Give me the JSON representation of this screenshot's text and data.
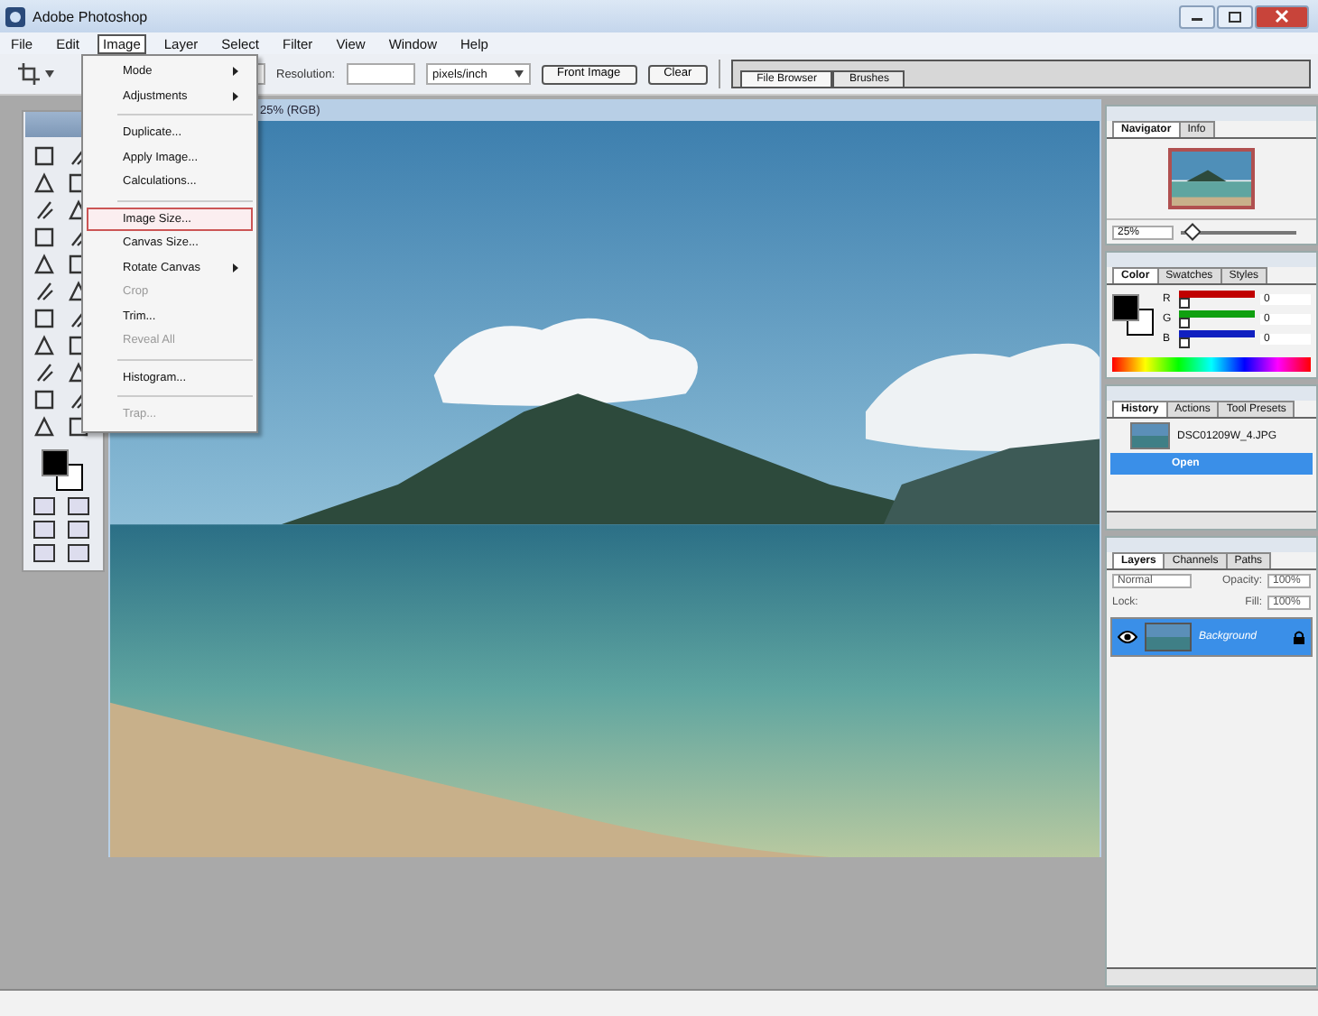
{
  "window": {
    "title": "Adobe Photoshop"
  },
  "menu": [
    {
      "label": "File",
      "selected": false
    },
    {
      "label": "Edit",
      "selected": false
    },
    {
      "label": "Image",
      "selected": true
    },
    {
      "label": "Layer",
      "selected": false
    },
    {
      "label": "Select",
      "selected": false
    },
    {
      "label": "Filter",
      "selected": false
    },
    {
      "label": "View",
      "selected": false
    },
    {
      "label": "Window",
      "selected": false
    },
    {
      "label": "Help",
      "selected": false
    }
  ],
  "options_bar": {
    "resolution_label": "Resolution:",
    "units": "pixels/inch",
    "front_image": "Front Image",
    "clear": "Clear"
  },
  "palette_well": [
    {
      "label": "File Browser",
      "selected": true
    },
    {
      "label": "Brushes",
      "selected": false
    }
  ],
  "image_menu": [
    {
      "kind": "item",
      "label": "Mode",
      "submenu": true,
      "disabled": false,
      "selected": false
    },
    {
      "kind": "item",
      "label": "Adjustments",
      "submenu": true,
      "disabled": false,
      "selected": false
    },
    {
      "kind": "separator"
    },
    {
      "kind": "item",
      "label": "Duplicate...",
      "submenu": false,
      "disabled": false,
      "selected": false
    },
    {
      "kind": "item",
      "label": "Apply Image...",
      "submenu": false,
      "disabled": false,
      "selected": false
    },
    {
      "kind": "item",
      "label": "Calculations...",
      "submenu": false,
      "disabled": false,
      "selected": false
    },
    {
      "kind": "separator"
    },
    {
      "kind": "item",
      "label": "Image Size...",
      "submenu": false,
      "disabled": false,
      "selected": true
    },
    {
      "kind": "item",
      "label": "Canvas Size...",
      "submenu": false,
      "disabled": false,
      "selected": false
    },
    {
      "kind": "item",
      "label": "Rotate Canvas",
      "submenu": true,
      "disabled": false,
      "selected": false
    },
    {
      "kind": "item",
      "label": "Crop",
      "submenu": false,
      "disabled": true,
      "selected": false
    },
    {
      "kind": "item",
      "label": "Trim...",
      "submenu": false,
      "disabled": false,
      "selected": false
    },
    {
      "kind": "item",
      "label": "Reveal All",
      "submenu": false,
      "disabled": true,
      "selected": false
    },
    {
      "kind": "separator"
    },
    {
      "kind": "item",
      "label": "Histogram...",
      "submenu": false,
      "disabled": false,
      "selected": false
    },
    {
      "kind": "separator"
    },
    {
      "kind": "item",
      "label": "Trap...",
      "submenu": false,
      "disabled": true,
      "selected": false
    }
  ],
  "document": {
    "title": "25% (RGB)"
  },
  "navigator": {
    "tabs": [
      {
        "label": "Navigator",
        "selected": true
      },
      {
        "label": "Info",
        "selected": false
      }
    ],
    "zoom": "25%",
    "level": 0.05
  },
  "color": {
    "tabs": [
      {
        "label": "Color",
        "selected": true
      },
      {
        "label": "Swatches",
        "selected": false
      },
      {
        "label": "Styles",
        "selected": false
      }
    ],
    "channels": [
      {
        "name": "R",
        "value": "0",
        "color": "#c00000",
        "level": 0
      },
      {
        "name": "G",
        "value": "0",
        "color": "#10a010",
        "level": 0
      },
      {
        "name": "B",
        "value": "0",
        "color": "#1020c0",
        "level": 0
      }
    ]
  },
  "history": {
    "tabs": [
      {
        "label": "History",
        "selected": true
      },
      {
        "label": "Actions",
        "selected": false
      },
      {
        "label": "Tool Presets",
        "selected": false
      }
    ],
    "snapshot": "DSC01209W_4.JPG",
    "states": [
      {
        "label": "Open",
        "selected": true
      }
    ]
  },
  "layers": {
    "tabs": [
      {
        "label": "Layers",
        "selected": true
      },
      {
        "label": "Channels",
        "selected": false
      },
      {
        "label": "Paths",
        "selected": false
      }
    ],
    "blend_mode": "Normal",
    "opacity_label": "Opacity:",
    "opacity": "100%",
    "lock_label": "Lock:",
    "fill_label": "Fill:",
    "fill": "100%",
    "items": [
      {
        "name": "Background",
        "selected": true,
        "visible": true,
        "locked": true
      }
    ]
  }
}
